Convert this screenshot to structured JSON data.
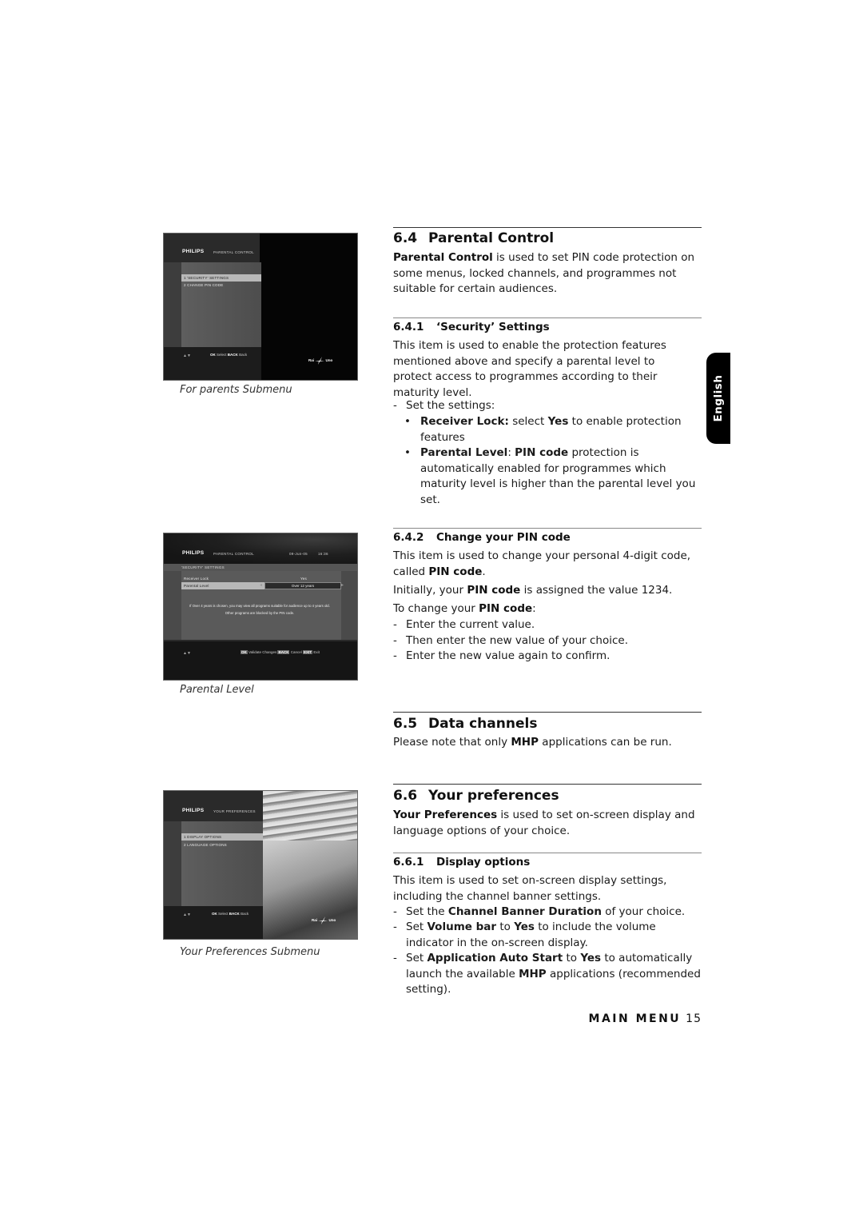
{
  "screens": {
    "parents_submenu": {
      "brand": "PHILIPS",
      "menu_title": "PARENTAL CONTROL",
      "items": [
        "1  'SECURITY' SETTINGS",
        "2  CHANGE PIN CODE"
      ],
      "selected_index": 0,
      "nav_arrows": "▲▼",
      "keys": [
        {
          "key": "OK",
          "label": "Select"
        },
        {
          "key": "BACK",
          "label": "Back"
        }
      ],
      "channel_logo": {
        "left": "Rai",
        "right": "Uno"
      }
    },
    "parental_level": {
      "brand": "PHILIPS",
      "menu_title": "PARENTAL CONTROL",
      "date": "09-Jun-05",
      "time": "16:36",
      "section": "'SECURITY' SETTINGS",
      "rows": [
        {
          "label": "Receiver Lock",
          "value": "Yes"
        },
        {
          "label": "Parental Level",
          "value": "Over 12 years"
        }
      ],
      "selected_row": 1,
      "help_text": "If Over 4 years is chosen, you may view all programs suitable for audience up to 4 years old. Other programs are blocked by the PIN code.",
      "nav_arrows": "▲▼",
      "keys": [
        {
          "key": "OK",
          "label": "Validate Changes"
        },
        {
          "key": "BACK",
          "label": "Cancel"
        },
        {
          "key": "EXIT",
          "label": "Exit"
        }
      ]
    },
    "preferences_submenu": {
      "brand": "PHILIPS",
      "menu_title": "YOUR PREFERENCES",
      "items": [
        "1  DISPLAY OPTIONS",
        "2  LANGUAGE OPTIONS"
      ],
      "selected_index": 0,
      "nav_arrows": "▲▼",
      "keys": [
        {
          "key": "OK",
          "label": "Select"
        },
        {
          "key": "BACK",
          "label": "Back"
        }
      ],
      "channel_logo": {
        "left": "Rai",
        "right": "Uno"
      }
    }
  },
  "captions": {
    "parents_submenu": "For parents Submenu",
    "parental_level": "Parental Level",
    "preferences_submenu": "Your Preferences Submenu"
  },
  "language_tab": "English",
  "sections": {
    "s6_4": {
      "number": "6.4",
      "title": "Parental Control",
      "intro_bold": "Parental Control",
      "intro_rest": " is used to set PIN code protection on some menus, locked channels, and programmes not suitable for certain audiences."
    },
    "s6_4_1": {
      "number": "6.4.1",
      "title": "‘Security’ Settings",
      "body": "This item is used to enable the protection features mentioned above and specify a parental level to protect access to programmes according to their maturity level.",
      "dash_item": "Set the settings:",
      "bullets": [
        {
          "bold1": "Receiver Lock:",
          "t1": " select ",
          "bold2": "Yes",
          "t2": " to enable protection features"
        },
        {
          "bold1": "Parental Level",
          "t1": ": ",
          "bold2": "PIN code",
          "t2": " protection is automatically enabled for programmes which maturity level is higher than the parental level you set."
        }
      ]
    },
    "s6_4_2": {
      "number": "6.4.2",
      "title": "Change your PIN code",
      "p1_a": "This item is used to change your personal 4-digit code, called ",
      "p1_b": "PIN code",
      "p1_c": ".",
      "p2_a": "Initially, your ",
      "p2_b": "PIN code",
      "p2_c": " is assigned the value 1234.",
      "p3_a": "To change your ",
      "p3_b": "PIN code",
      "p3_c": ":",
      "steps": [
        "Enter the current value.",
        "Then enter the new value of your choice.",
        "Enter the new value again to confirm."
      ]
    },
    "s6_5": {
      "number": "6.5",
      "title": "Data channels",
      "p_a": "Please note that only ",
      "p_b": "MHP",
      "p_c": " applications can be run."
    },
    "s6_6": {
      "number": "6.6",
      "title": "Your preferences",
      "intro_bold": "Your Preferences",
      "intro_rest": " is used to set on-screen display and language options of your choice."
    },
    "s6_6_1": {
      "number": "6.6.1",
      "title": "Display options",
      "body": "This item is used to set on-screen display settings, including the channel banner settings.",
      "steps": [
        {
          "a": "Set the ",
          "b": "Channel Banner Duration",
          "c": " of your choice.",
          "d": "",
          "e": "",
          "f": "",
          "g": ""
        },
        {
          "a": "Set ",
          "b": "Volume bar",
          "c": " to ",
          "d": "Yes",
          "e": " to include the volume indicator in the on-screen display.",
          "f": "",
          "g": ""
        },
        {
          "a": "Set ",
          "b": "Application Auto Start",
          "c": " to ",
          "d": "Yes",
          "e": " to automatically launch the available ",
          "f": "MHP",
          "g": " applications (recommended setting)."
        }
      ]
    }
  },
  "footer": {
    "section": "MAIN MENU",
    "page": "15"
  }
}
